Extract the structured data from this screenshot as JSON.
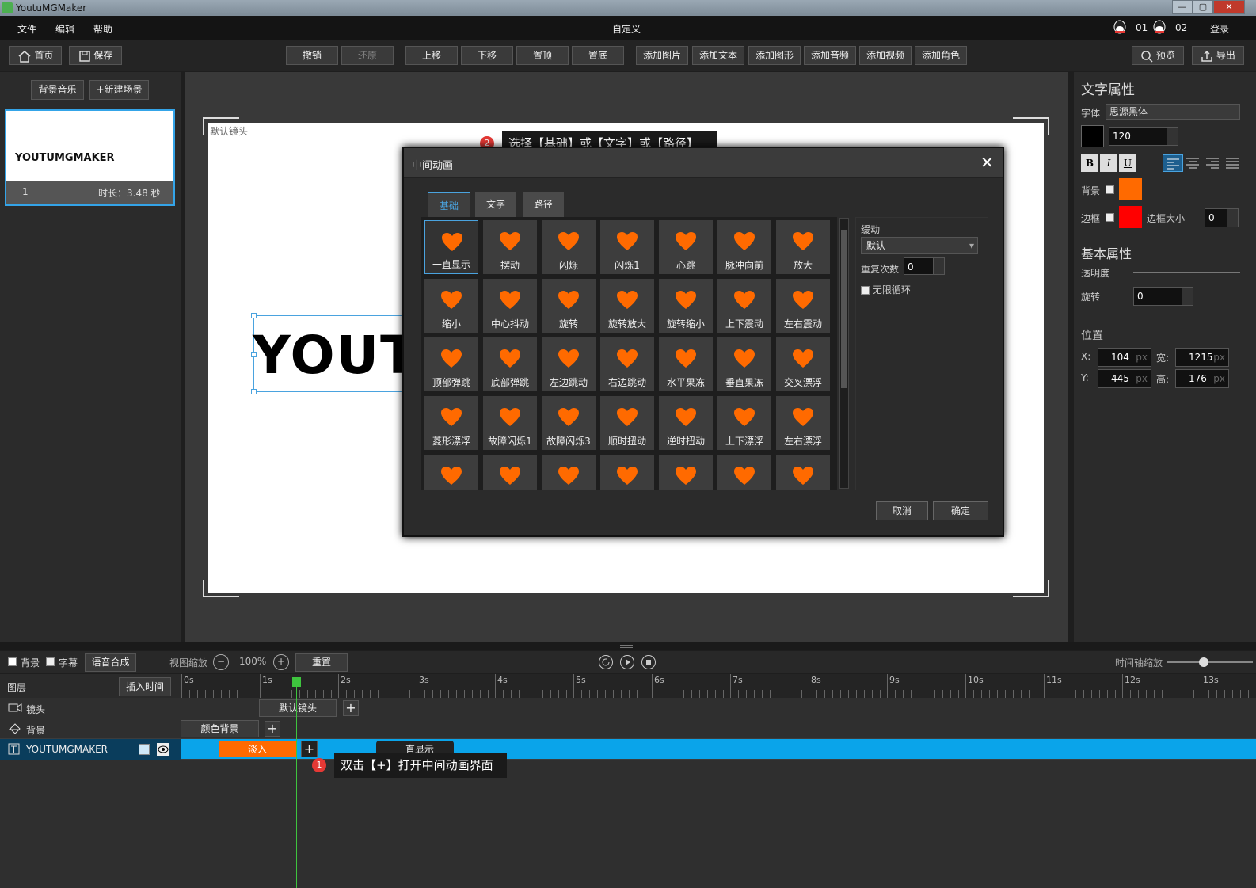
{
  "window": {
    "title": "YoutuMGMaker",
    "controls": [
      "—",
      "▢",
      "✕"
    ]
  },
  "menubar": {
    "items": [
      "文件",
      "编辑",
      "帮助"
    ],
    "center_title": "自定义",
    "qq1": "01",
    "qq2": "02",
    "login": "登录"
  },
  "toolbar": {
    "home": "首页",
    "save": "保存",
    "undo": "撤销",
    "redo": "还原",
    "move_up": "上移",
    "move_down": "下移",
    "to_top": "置顶",
    "to_bottom": "置底",
    "add_image": "添加图片",
    "add_text": "添加文本",
    "add_shape": "添加图形",
    "add_audio": "添加音频",
    "add_video": "添加视频",
    "add_role": "添加角色",
    "preview": "预览",
    "export": "导出"
  },
  "left": {
    "bg_music": "背景音乐",
    "new_scene": "+新建场景",
    "scene_text": "YOUTUMGMAKER",
    "scene_index": "1",
    "scene_duration": "时长：3.48 秒"
  },
  "canvas": {
    "camera_label": "默认镜头",
    "text": "YOUT"
  },
  "tips": {
    "tip2_num": "2",
    "tip2": "选择【基础】或【文字】或【路径】",
    "tip1_num": "1",
    "tip1": "双击【+】打开中间动画界面"
  },
  "dialog": {
    "title": "中间动画",
    "close": "✕",
    "tabs": [
      "基础",
      "文字",
      "路径"
    ],
    "items": [
      "一直显示",
      "摆动",
      "闪烁",
      "闪烁1",
      "心跳",
      "脉冲向前",
      "放大",
      "缩小",
      "中心抖动",
      "旋转",
      "旋转放大",
      "旋转缩小",
      "上下震动",
      "左右震动",
      "顶部弹跳",
      "底部弹跳",
      "左边跳动",
      "右边跳动",
      "水平果冻",
      "垂直果冻",
      "交叉漂浮",
      "菱形漂浮",
      "故障闪烁1",
      "故障闪烁3",
      "顺时扭动",
      "逆时扭动",
      "上下漂浮",
      "左右漂浮",
      "",
      "",
      "",
      "",
      "",
      "",
      ""
    ],
    "easing_label": "缓动",
    "easing_value": "默认",
    "repeat_label": "重复次数",
    "repeat_value": "0",
    "infinite_label": "无限循环",
    "cancel": "取消",
    "ok": "确定",
    "accent": "#ff6a00"
  },
  "right": {
    "text_props": "文字属性",
    "font_label": "字体",
    "font_value": "思源黑体",
    "font_size": "120",
    "bold": "B",
    "italic": "I",
    "underline": "U",
    "bg_label": "背景",
    "border_label": "边框",
    "border_size_label": "边框大小",
    "border_size": "0",
    "bg_color": "#ff6a00",
    "border_color": "#ff0000",
    "text_color": "#000000",
    "basic_props": "基本属性",
    "opacity_label": "透明度",
    "rotate_label": "旋转",
    "rotate_value": "0",
    "pos_label": "位置",
    "x_label": "X:",
    "x": "104",
    "y_label": "Y:",
    "y": "445",
    "w_label": "宽:",
    "w": "1215",
    "h_label": "高:",
    "h": "176",
    "unit": "px"
  },
  "timeline_bar": {
    "bg": "背景",
    "subtitle": "字幕",
    "tts": "语音合成",
    "zoom_label": "视图缩放",
    "zoom": "100%",
    "reset": "重置",
    "tl_zoom": "时间轴缩放"
  },
  "timeline": {
    "layers_label": "图层",
    "insert_time": "插入时间",
    "ticks": [
      "0s",
      "1s",
      "2s",
      "3s",
      "4s",
      "5s",
      "6s",
      "7s",
      "8s",
      "9s",
      "10s",
      "11s",
      "12s",
      "13s"
    ],
    "rows": [
      {
        "name": "镜头",
        "clip": "默认镜头"
      },
      {
        "name": "背景",
        "clip": "颜色背景"
      },
      {
        "name": "YOUTUMGMAKER",
        "clip1": "淡入",
        "clip2": "一直显示"
      }
    ]
  }
}
